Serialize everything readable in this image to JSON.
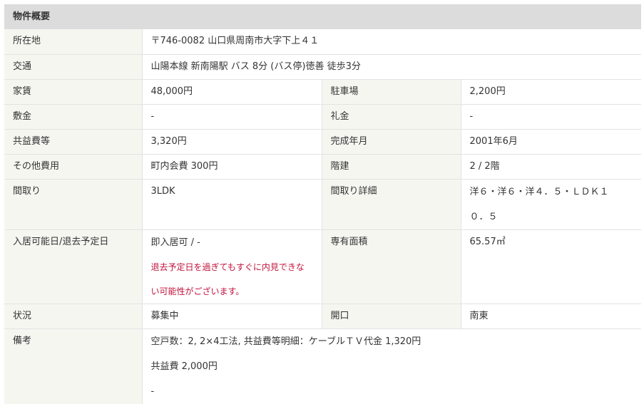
{
  "section_title": "物件概要",
  "rows": {
    "address": {
      "label": "所在地",
      "value": "〒746-0082 山口県周南市大字下上４１"
    },
    "transport": {
      "label": "交通",
      "value": "山陽本線 新南陽駅 バス 8分 (バス停)徳善 徒歩3分"
    },
    "rent": {
      "label": "家賃",
      "value": "48,000円",
      "label2": "駐車場",
      "value2": "2,200円"
    },
    "deposit": {
      "label": "敷金",
      "value": "-",
      "label2": "礼金",
      "value2": "-"
    },
    "common_fee": {
      "label": "共益費等",
      "value": "3,320円",
      "label2": "完成年月",
      "value2": "2001年6月"
    },
    "other_fee": {
      "label": "その他費用",
      "value": "町内会費 300円",
      "label2": "階建",
      "value2": "2 / 2階"
    },
    "layout": {
      "label": "間取り",
      "value": "3LDK",
      "label2": "間取り詳細",
      "value2_line1": "洋６・洋６・洋４．５・ＬＤＫ１",
      "value2_line2": "０．５"
    },
    "move_in": {
      "label": "入居可能日/退去予定日",
      "value": "即入居可 / -",
      "note_line1": "退去予定日を過ぎてもすぐに内見できな",
      "note_line2": "い可能性がございます。",
      "label2": "専有面積",
      "value2": "65.57㎡"
    },
    "status": {
      "label": "状況",
      "value": "募集中",
      "label2": "開口",
      "value2": "南東"
    },
    "remarks": {
      "label": "備考",
      "line1": "空戸数：2, 2×4工法, 共益費等明細：ケーブルＴＶ代金 1,320円",
      "line2": "共益費 2,000円",
      "line3": "-"
    }
  }
}
